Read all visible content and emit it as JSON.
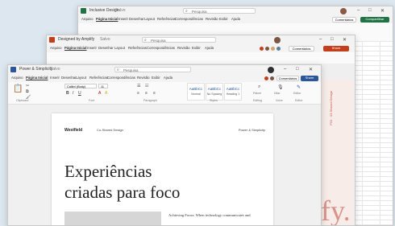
{
  "excel": {
    "title": "Inclusive Design",
    "saved": "Salvo",
    "search": "Pesquisa",
    "menu": [
      "Arquivo",
      "Página Inicial",
      "Inserir",
      "Desenhar",
      "Layout",
      "Referências",
      "Correspondências",
      "Revisão",
      "Exibir",
      "Ajuda"
    ],
    "comments": "Comentários",
    "share": "Compartilhar"
  },
  "ppt": {
    "title": "Designed by Amplify",
    "saved": "Salvo",
    "search": "Pesquisa",
    "menu": [
      "Arquivo",
      "Página Inicial",
      "Inserir",
      "Desenhar",
      "Layout",
      "Referências",
      "Correspondências",
      "Revisão",
      "Exibir",
      "Ajuda"
    ],
    "comments": "Comentários",
    "share": "Share"
  },
  "word": {
    "title": "Power & Simplicity",
    "saved": "Salvo",
    "search": "Pesquisa",
    "menu": [
      "Arquivo",
      "Página Inicial",
      "Inserir",
      "Desenhar",
      "Layout",
      "Referências",
      "Correspondências",
      "Revisão",
      "Exibir",
      "Ajuda"
    ],
    "comments": "Comentários",
    "share": "Share",
    "font_name": "Calibri (Body)",
    "font_size": "11",
    "styles": [
      {
        "sample": "AaBbCc",
        "name": "Normal"
      },
      {
        "sample": "AaBbCc",
        "name": "No Spacing"
      },
      {
        "sample": "AaBbCc",
        "name": "Heading 1"
      }
    ],
    "groups": [
      "Clipboard",
      "Font",
      "Paragraph",
      "Styles",
      "Editing",
      "Voice",
      "Editor"
    ],
    "tools": [
      "Painel",
      "Ditar",
      "Editor"
    ],
    "doc": {
      "brand": "Westfield",
      "header_center": "Co-Shared Design",
      "header_right": "Power & Simplicity",
      "headline_1": "Experiências",
      "headline_2": "criadas para foco",
      "body_start": "Achieving Focus: When technology communicates and"
    },
    "side_text": "P01 · 03 Shared Design",
    "side_large": "fy."
  },
  "colors": {
    "word": "#2b579a",
    "excel": "#217346",
    "ppt": "#c43e1c",
    "background": "#dde7ef"
  }
}
